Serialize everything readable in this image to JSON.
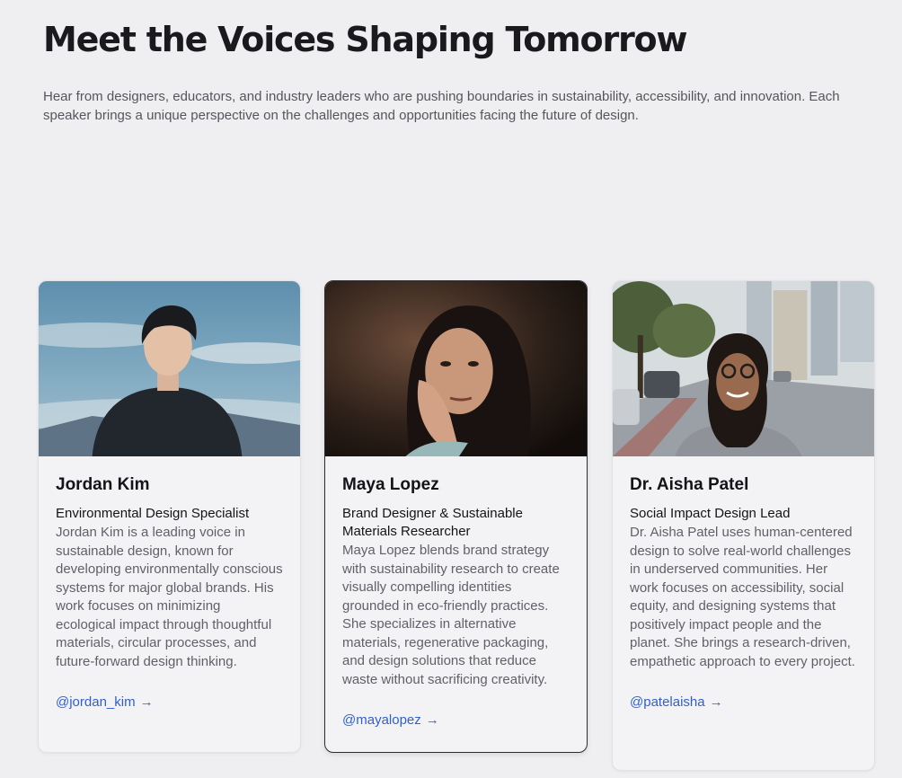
{
  "header": {
    "title": "Meet the Voices Shaping Tomorrow",
    "intro": "Hear from designers, educators, and industry leaders who are pushing boundaries in sustainability, accessibility, and innovation. Each speaker brings a unique perspective on the challenges and opportunities facing the future of design."
  },
  "speakers": [
    {
      "name": "Jordan Kim",
      "role": "Environmental Design Specialist",
      "bio": "Jordan Kim is a leading voice in sustainable design, known for developing environmentally conscious systems for major global brands. His work focuses on minimizing ecological impact through thoughtful materials, circular processes, and future-forward design thinking.",
      "handle": "@jordan_kim",
      "arrow": "→"
    },
    {
      "name": "Maya Lopez",
      "role": "Brand Designer & Sustainable Materials Researcher",
      "bio": "Maya Lopez blends brand strategy with sustainability research to create visually compelling identities grounded in eco-friendly practices. She specializes in alternative materials, regenerative packaging, and design solutions that reduce waste without sacrificing creativity.",
      "handle": "@mayalopez",
      "arrow": "→"
    },
    {
      "name": "Dr. Aisha Patel",
      "role": "Social Impact Design Lead",
      "bio": "Dr. Aisha Patel uses human-centered design to solve real-world challenges in underserved communities. Her work focuses on accessibility, social equity, and designing systems that positively impact people and the planet. She brings a research-driven, empathetic approach to every project.",
      "handle": "@patelaisha",
      "arrow": "→"
    }
  ],
  "colors": {
    "background": "#efeff1",
    "link": "#2f5fd0",
    "active_border": "#2c2c30"
  }
}
